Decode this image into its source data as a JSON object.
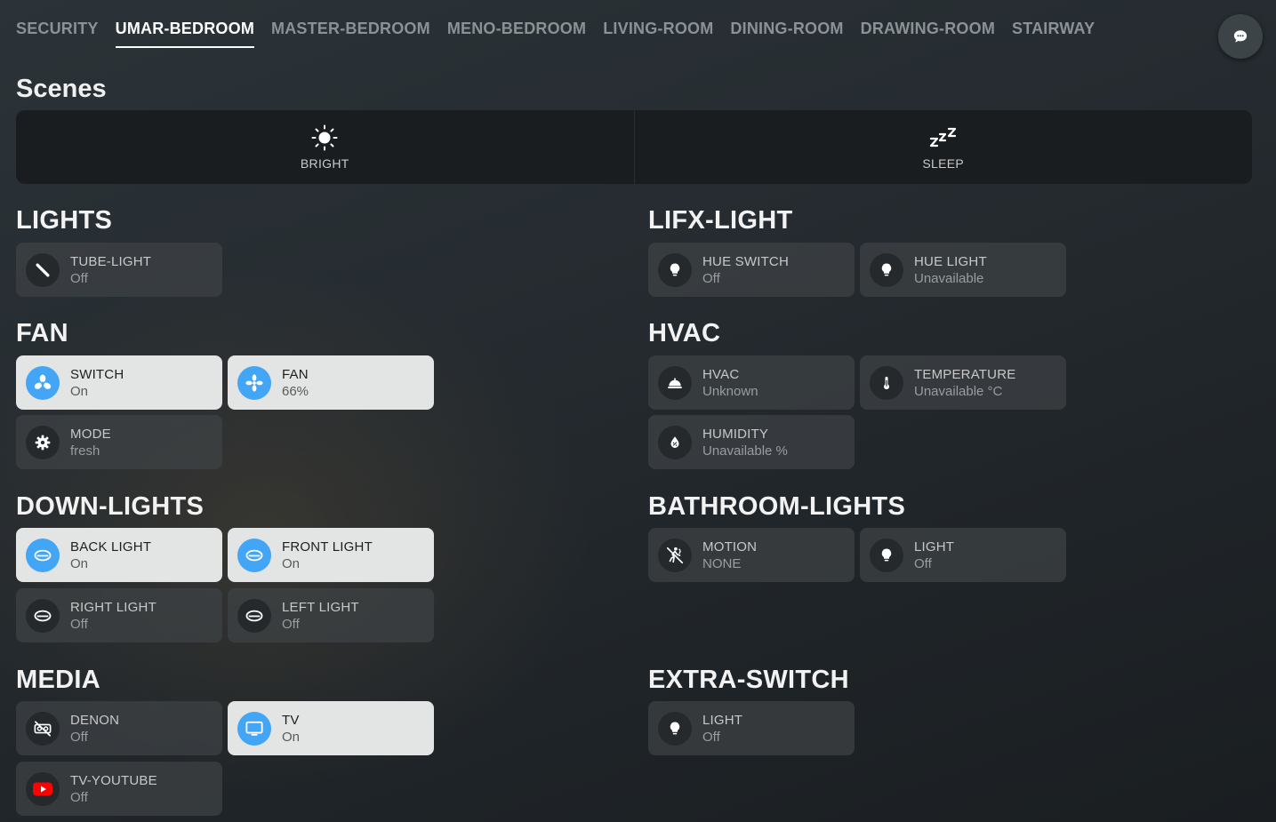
{
  "tabs": [
    "SECURITY",
    "UMAR-BEDROOM",
    "MASTER-BEDROOM",
    "MENO-BEDROOM",
    "LIVING-ROOM",
    "DINING-ROOM",
    "DRAWING-ROOM",
    "STAIRWAY"
  ],
  "active_tab": "UMAR-BEDROOM",
  "chat_button_icon": "chat-bubble-icon",
  "scenes": {
    "title": "Scenes",
    "items": [
      {
        "label": "BRIGHT",
        "icon": "sun-icon"
      },
      {
        "label": "SLEEP",
        "icon": "zzz-icon"
      }
    ]
  },
  "colors": {
    "accent": "#42a5f5",
    "tile_on": "#e3e4e4",
    "tile_off": "#3e4245",
    "youtube_red": "#ff0000"
  },
  "sections": {
    "lights": {
      "title": "LIGHTS",
      "tiles": [
        {
          "name": "TUBE-LIGHT",
          "state": "Off",
          "icon": "tube-light-icon"
        }
      ]
    },
    "lifx": {
      "title": "LIFX-LIGHT",
      "tiles": [
        {
          "name": "HUE SWITCH",
          "state": "Off",
          "icon": "bulb-icon"
        },
        {
          "name": "HUE LIGHT",
          "state": "Unavailable",
          "icon": "bulb-icon"
        }
      ]
    },
    "fan": {
      "title": "FAN",
      "tiles": [
        {
          "name": "SWITCH",
          "state": "On",
          "icon": "fan-icon"
        },
        {
          "name": "FAN",
          "state": "66%",
          "icon": "fan-icon"
        },
        {
          "name": "MODE",
          "state": "fresh",
          "icon": "gear-icon"
        }
      ]
    },
    "hvac": {
      "title": "HVAC",
      "tiles": [
        {
          "name": "HVAC",
          "state": "Unknown",
          "icon": "dome-icon"
        },
        {
          "name": "TEMPERATURE",
          "state": "Unavailable °C",
          "icon": "thermometer-icon"
        },
        {
          "name": "HUMIDITY",
          "state": "Unavailable %",
          "icon": "water-drop-icon"
        }
      ]
    },
    "downlights": {
      "title": "DOWN-LIGHTS",
      "tiles": [
        {
          "name": "BACK LIGHT",
          "state": "On",
          "icon": "downlight-icon"
        },
        {
          "name": "FRONT LIGHT",
          "state": "On",
          "icon": "downlight-icon"
        },
        {
          "name": "RIGHT LIGHT",
          "state": "Off",
          "icon": "downlight-icon"
        },
        {
          "name": "LEFT LIGHT",
          "state": "Off",
          "icon": "downlight-icon"
        }
      ]
    },
    "bathroom": {
      "title": "BATHROOM-LIGHTS",
      "tiles": [
        {
          "name": "MOTION",
          "state": "NONE",
          "icon": "motion-off-icon"
        },
        {
          "name": "LIGHT",
          "state": "Off",
          "icon": "bulb-icon"
        }
      ]
    },
    "media": {
      "title": "MEDIA",
      "tiles": [
        {
          "name": "DENON",
          "state": "Off",
          "icon": "speaker-off-icon"
        },
        {
          "name": "TV",
          "state": "On",
          "icon": "monitor-icon"
        },
        {
          "name": "TV-YOUTUBE",
          "state": "Off",
          "icon": "youtube-icon"
        }
      ]
    },
    "extra": {
      "title": "EXTRA-SWITCH",
      "tiles": [
        {
          "name": "LIGHT",
          "state": "Off",
          "icon": "bulb-icon"
        }
      ]
    }
  }
}
